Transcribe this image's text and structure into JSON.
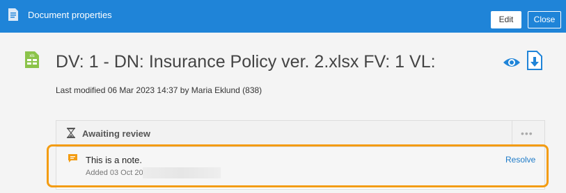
{
  "window": {
    "title": "Document properties"
  },
  "toolbar": {
    "edit_label": "Edit",
    "close_label": "Close"
  },
  "document": {
    "title": "DV: 1 - DN: Insurance Policy ver. 2.xlsx FV: 1 VL:",
    "file_type": "xls",
    "modified": "Last modified 06 Mar 2023 14:37 by Maria Eklund (838)"
  },
  "review": {
    "status": "Awaiting review",
    "more_label": "•••",
    "note": {
      "text": "This is a note.",
      "meta": "Added 03 Oct 2023 12:14 by",
      "resolve_label": "Resolve"
    }
  },
  "colors": {
    "accent": "#1f84d8",
    "highlight": "#f39c12",
    "note": "#f39c12",
    "xls": "#8bc34a"
  },
  "icons": [
    "document-icon",
    "xls-file-icon",
    "eye-icon",
    "download-icon",
    "hourglass-icon",
    "note-icon",
    "more-icon"
  ]
}
